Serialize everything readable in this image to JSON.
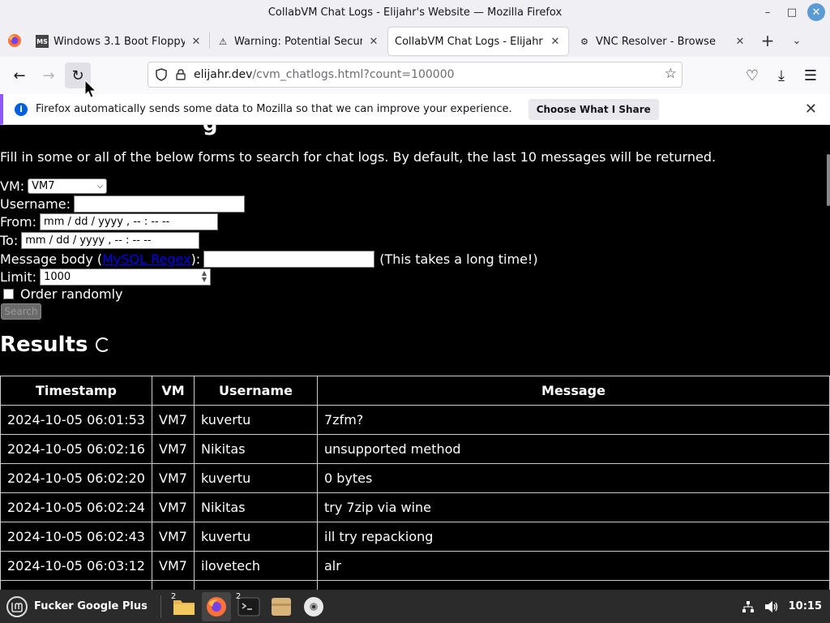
{
  "window": {
    "title": "CollabVM Chat Logs - Elijahr's Website — Mozilla Firefox",
    "min_label": "–",
    "max_label": "□",
    "close_label": "✕"
  },
  "tabs": [
    {
      "label": "Windows 3.1 Boot Floppy - C",
      "icon": "ms-dos-icon",
      "icon_text": "MS",
      "close": "✕"
    },
    {
      "label": "Warning: Potential Security",
      "icon": "warning-icon",
      "icon_text": "⚠",
      "close": "✕"
    },
    {
      "label": "CollabVM Chat Logs - Elijahr's W",
      "icon": "none",
      "icon_text": "",
      "close": "✕"
    },
    {
      "label": "VNC Resolver - Browse",
      "icon": "vnc-icon",
      "icon_text": "⚙",
      "close": "✕"
    }
  ],
  "tabbar": {
    "new_tab": "+",
    "list_tabs": "⌄"
  },
  "nav": {
    "back": "←",
    "forward": "→",
    "reload": "↻",
    "url_host": "elijahr.dev",
    "url_path": "/cvm_chatlogs.html?count=100000",
    "star": "☆",
    "pocket": "♡",
    "download": "⤓",
    "menu": "☰"
  },
  "notification": {
    "text": "Firefox automatically sends some data to Mozilla so that we can improve your experience.",
    "button": "Choose What I Share",
    "close": "✕",
    "info": "i"
  },
  "page": {
    "heading_fragment": "g",
    "intro": "Fill in some or all of the below forms to search for chat logs. By default, the last 10 messages will be returned.",
    "vm_label": "VM:",
    "vm_value": "VM7",
    "username_label": "Username:",
    "from_label": "From:",
    "from_placeholder": "mm / dd / yyyy ,  -- : --   --",
    "to_label": "To:",
    "to_placeholder": "mm / dd / yyyy ,  -- : --   --",
    "message_label_pre": "Message body (",
    "message_link": "MySQL Regex",
    "message_label_post": "):",
    "message_note": "(This takes a long time!)",
    "limit_label": "Limit:",
    "limit_value": "1000",
    "random_label": "Order randomly",
    "search_button": "Search",
    "results_heading": "Results"
  },
  "table": {
    "headers": [
      "Timestamp",
      "VM",
      "Username",
      "Message"
    ],
    "rows": [
      [
        "2024-10-05 06:01:53",
        "VM7",
        "kuvertu",
        "7zfm?"
      ],
      [
        "2024-10-05 06:02:16",
        "VM7",
        "Nikitas",
        "unsupported method"
      ],
      [
        "2024-10-05 06:02:20",
        "VM7",
        "kuvertu",
        "0 bytes"
      ],
      [
        "2024-10-05 06:02:24",
        "VM7",
        "Nikitas",
        "try 7zip via wine"
      ],
      [
        "2024-10-05 06:02:43",
        "VM7",
        "kuvertu",
        "ill try repackiong"
      ],
      [
        "2024-10-05 06:03:12",
        "VM7",
        "ilovetech",
        "alr"
      ]
    ]
  },
  "taskbar": {
    "menu_label": "Fucker Google Plus",
    "files_badge": "2",
    "terminal_badge": "2",
    "clock": "10:15"
  },
  "colors": {
    "accent": "#9059ff",
    "info": "#0060df",
    "link": "#0000ee"
  }
}
